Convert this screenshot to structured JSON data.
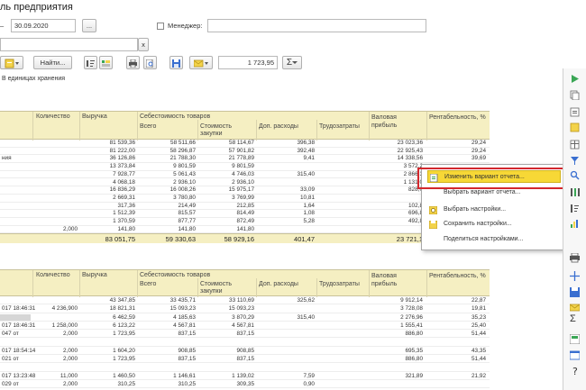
{
  "title": "ль предприятия",
  "filters": {
    "date_to": "30.09.2020",
    "date_separator": "–",
    "pick_label": "...",
    "manager_label": "Менеджер:",
    "clear_label": "x"
  },
  "toolbar": {
    "find_label": "Найти...",
    "sum_value": "1 723,95",
    "sum_symbol": "Σ"
  },
  "units_caption": "В единицах хранения",
  "table_top": {
    "headers": {
      "quantity": "Количество",
      "revenue": "Выручка",
      "cost_group": "Себестоимость товаров",
      "total": "Всего",
      "purchase_cost": "Стоимость закупки",
      "extra_costs": "Доп. расходы",
      "labor_costs": "Трудозатраты",
      "gross_profit": "Валовая прибыль",
      "profitability": "Рентабельность, %"
    },
    "rows": [
      {
        "label": "",
        "qty": "",
        "rev": "81 539,36",
        "tot": "58 511,66",
        "buy": "58 114,67",
        "ext": "396,38",
        "gp": "23 023,36",
        "rp": "29,24"
      },
      {
        "label": "",
        "qty": "",
        "rev": "81 222,00",
        "tot": "58 296,87",
        "buy": "57 901,82",
        "ext": "392,48",
        "gp": "22 925,43",
        "rp": "29,24"
      },
      {
        "label": "ния",
        "qty": "",
        "rev": "36 126,86",
        "tot": "21 788,30",
        "buy": "21 778,89",
        "ext": "9,41",
        "gp": "14 338,56",
        "rp": "39,69"
      },
      {
        "label": "",
        "qty": "",
        "rev": "13 373,84",
        "tot": "9 801,59",
        "buy": "9 801,59",
        "ext": "",
        "gp": "3 572,2",
        "rp": ""
      },
      {
        "label": "",
        "qty": "",
        "rev": "7 928,77",
        "tot": "5 061,43",
        "buy": "4 746,03",
        "ext": "315,40",
        "gp": "2 866,3",
        "rp": ""
      },
      {
        "label": "",
        "qty": "",
        "rev": "4 068,18",
        "tot": "2 936,10",
        "buy": "2 936,10",
        "ext": "",
        "gp": "1 131,0",
        "rp": ""
      },
      {
        "label": "",
        "qty": "",
        "rev": "16 836,29",
        "tot": "16 008,26",
        "buy": "15 975,17",
        "ext": "33,09",
        "gp": "828,0",
        "rp": ""
      },
      {
        "label": "",
        "qty": "",
        "rev": "2 669,31",
        "tot": "3 780,80",
        "buy": "3 769,99",
        "ext": "10,81",
        "gp": "",
        "rp": ""
      },
      {
        "label": "",
        "qty": "",
        "rev": "317,36",
        "tot": "214,49",
        "buy": "212,85",
        "ext": "1,64",
        "gp": "102,8",
        "rp": ""
      },
      {
        "label": "",
        "qty": "",
        "rev": "1 512,39",
        "tot": "815,57",
        "buy": "814,49",
        "ext": "1,08",
        "gp": "696,8",
        "rp": ""
      },
      {
        "label": "",
        "qty": "",
        "rev": "1 370,59",
        "tot": "877,77",
        "buy": "872,49",
        "ext": "5,28",
        "gp": "492,8",
        "rp": ""
      },
      {
        "label": "",
        "qty": "2,000",
        "rev": "141,80",
        "tot": "141,80",
        "buy": "141,80",
        "ext": "",
        "gp": "",
        "rp": ""
      }
    ],
    "totals": {
      "rev": "83 051,75",
      "tot": "59 330,63",
      "buy": "58 929,16",
      "ext": "401,47",
      "gp": "23 721,1"
    }
  },
  "table_bottom": {
    "headers": {
      "quantity": "Количество",
      "revenue": "Выручка",
      "cost_group": "Себестоимость товаров",
      "total": "Всего",
      "purchase_cost": "Стоимость закупки",
      "extra_costs": "Доп. расходы",
      "labor_costs": "Трудозатраты",
      "gross_profit": "Валовая прибыль",
      "profitability": "Рентабельность, %"
    },
    "rows": [
      {
        "label": "",
        "qty": "",
        "rev": "43 347,85",
        "tot": "33 435,71",
        "buy": "33 110,69",
        "ext": "325,62",
        "gp": "9 912,14",
        "rp": "22,87"
      },
      {
        "label": "017 18:46:31",
        "qty": "4 236,900",
        "rev": "18 821,31",
        "tot": "15 093,23",
        "buy": "15 093,23",
        "ext": "",
        "gp": "3 728,08",
        "rp": "19,81"
      },
      {
        "label": "",
        "qty": "",
        "rev": "6 462,59",
        "tot": "4 185,63",
        "buy": "3 870,29",
        "ext": "315,40",
        "gp": "2 276,96",
        "rp": "35,23"
      },
      {
        "label": "017 18:46:31",
        "qty": "1 258,000",
        "rev": "6 123,22",
        "tot": "4 567,81",
        "buy": "4 567,81",
        "ext": "",
        "gp": "1 555,41",
        "rp": "25,40"
      },
      {
        "label": "047 от",
        "qty": "2,000",
        "rev": "1 723,95",
        "tot": "837,15",
        "buy": "837,15",
        "ext": "",
        "gp": "886,80",
        "rp": "51,44"
      },
      {
        "label": "",
        "qty": "",
        "rev": "",
        "tot": "",
        "buy": "",
        "ext": "",
        "gp": "",
        "rp": ""
      },
      {
        "label": "017 18:54:14",
        "qty": "2,000",
        "rev": "1 604,20",
        "tot": "908,85",
        "buy": "908,85",
        "ext": "",
        "gp": "695,35",
        "rp": "43,35"
      },
      {
        "label": "021 от",
        "qty": "2,000",
        "rev": "1 723,95",
        "tot": "837,15",
        "buy": "837,15",
        "ext": "",
        "gp": "886,80",
        "rp": "51,44"
      },
      {
        "label": "",
        "qty": "",
        "rev": "",
        "tot": "",
        "buy": "",
        "ext": "",
        "gp": "",
        "rp": ""
      },
      {
        "label": "017 13:23:48",
        "qty": "11,000",
        "rev": "1 460,50",
        "tot": "1 146,61",
        "buy": "1 139,02",
        "ext": "7,59",
        "gp": "321,89",
        "rp": "21,92"
      },
      {
        "label": "029 от",
        "qty": "2,000",
        "rev": "310,25",
        "tot": "310,25",
        "buy": "309,35",
        "ext": "0,90",
        "gp": "",
        "rp": ""
      }
    ]
  },
  "context_menu": {
    "items": [
      {
        "label": "Изменить вариант отчета...",
        "icon": "edit-variant-icon",
        "active": true
      },
      {
        "label": "Выбрать вариант отчета...",
        "icon": "",
        "active": false
      },
      {
        "label": "Выбрать настройки...",
        "icon": "settings-icon",
        "active": false
      },
      {
        "label": "Сохранить настройки...",
        "icon": "save-settings-icon",
        "active": false
      },
      {
        "label": "Поделиться настройками...",
        "icon": "",
        "active": false
      }
    ]
  },
  "colors": {
    "header_bg": "#f5efc2",
    "menu_highlight": "#f7d836",
    "highlight_frame": "#d3282d",
    "accent_green": "#3aa655"
  }
}
